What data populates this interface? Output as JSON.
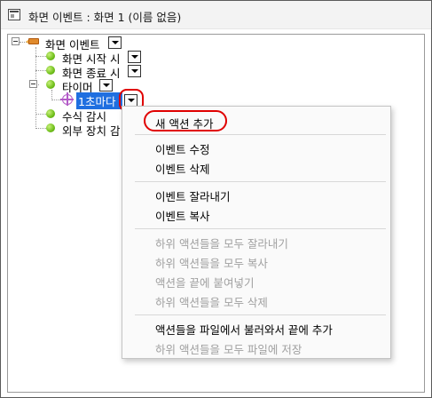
{
  "window": {
    "title": "화면 이벤트 : 화면 1 (이름 없음)"
  },
  "tree": {
    "root": {
      "label": "화면 이벤트",
      "icon": "megaphone-icon"
    },
    "children": [
      {
        "label": "화면 시작 시",
        "icon": "green-dot-icon"
      },
      {
        "label": "화면 종료 시",
        "icon": "green-dot-icon"
      },
      {
        "label": "타이머",
        "icon": "green-dot-icon"
      },
      {
        "label": "1초마다",
        "icon": "target-icon",
        "selected": true
      },
      {
        "label": "수식 감시",
        "icon": "green-dot-icon"
      },
      {
        "label": "외부 장치 감",
        "icon": "green-dot-icon"
      }
    ]
  },
  "context_menu": {
    "groups": [
      [
        {
          "label": "새 액션 추가",
          "enabled": true,
          "highlighted_with_red_circle": true
        }
      ],
      [
        {
          "label": "이벤트 수정",
          "enabled": true
        },
        {
          "label": "이벤트 삭제",
          "enabled": true
        }
      ],
      [
        {
          "label": "이벤트 잘라내기",
          "enabled": true
        },
        {
          "label": "이벤트 복사",
          "enabled": true
        }
      ],
      [
        {
          "label": "하위 액션들을 모두 잘라내기",
          "enabled": false
        },
        {
          "label": "하위 액션들을 모두 복사",
          "enabled": false
        },
        {
          "label": "액션을 끝에 붙여넣기",
          "enabled": false
        },
        {
          "label": "하위 액션들을 모두 삭제",
          "enabled": false
        }
      ],
      [
        {
          "label": "액션들을 파일에서 불러와서 끝에 추가",
          "enabled": true
        },
        {
          "label": "하위 액션들을 모두 파일에 저장",
          "enabled": false
        }
      ]
    ]
  },
  "colors": {
    "selection": "#1f6fe0",
    "annotation_ring": "#e00000",
    "disabled_text": "#a0a0a0",
    "dot_green": "#6fbf1a",
    "target_purple": "#b35bc7",
    "root_orange": "#e08a2c"
  }
}
